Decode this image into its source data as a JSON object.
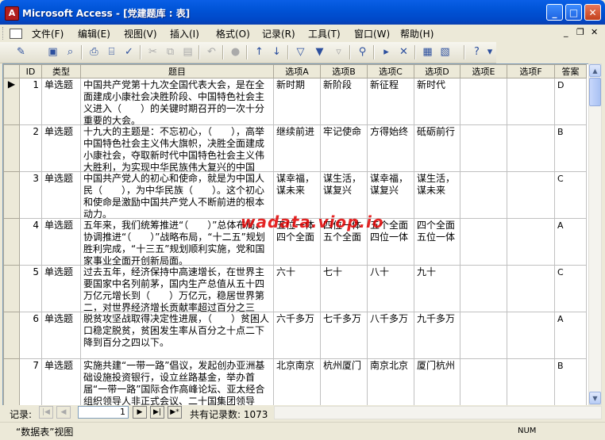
{
  "window": {
    "title": "Microsoft Access - [党建题库 : 表]",
    "app_icon": "access-icon"
  },
  "menubar": {
    "items": [
      {
        "label": "文件(F)"
      },
      {
        "label": "编辑(E)"
      },
      {
        "label": "视图(V)"
      },
      {
        "label": "插入(I)"
      },
      {
        "label": "格式(O)"
      },
      {
        "label": "记录(R)"
      },
      {
        "label": "工具(T)"
      },
      {
        "label": "窗口(W)"
      },
      {
        "label": "帮助(H)"
      }
    ]
  },
  "grid": {
    "columns": [
      "ID",
      "类型",
      "题目",
      "选项A",
      "选项B",
      "选项C",
      "选项D",
      "选项E",
      "选项F",
      "答案"
    ],
    "rows": [
      {
        "id": "1",
        "type": "单选题",
        "question": "中国共产党第十九次全国代表大会，是在全面建成小康社会决胜阶段、中国特色社会主义进入（　　）的关键时期召开的一次十分重要的大会。",
        "a": "新时期",
        "b": "新阶段",
        "c": "新征程",
        "d": "新时代",
        "e": "",
        "f": "",
        "answer": "D"
      },
      {
        "id": "2",
        "type": "单选题",
        "question": "十九大的主题是：不忘初心，（　　），高举中国特色社会主义伟大旗帜，决胜全面建成小康社会，夺取新时代中国特色社会主义伟大胜利，为实现中华民族伟大复兴的中国",
        "a": "继续前进",
        "b": "牢记使命",
        "c": "方得始终",
        "d": "砥砺前行",
        "e": "",
        "f": "",
        "answer": "B"
      },
      {
        "id": "3",
        "type": "单选题",
        "question": "中国共产党人的初心和使命，就是为中国人民（　　），为中华民族（　　）。这个初心和使命是激励中国共产党人不断前进的根本动力。",
        "a": "谋幸福，谋未来",
        "b": "谋生活，谋复兴",
        "c": "谋幸福，谋复兴",
        "d": "谋生活，谋未来",
        "e": "",
        "f": "",
        "answer": "C"
      },
      {
        "id": "4",
        "type": "单选题",
        "question": "五年来，我们统筹推进“（　　）”总体布局、协调推进“（　　）”战略布局，“十二五”规划胜利完成，“十三五”规划顺利实施，党和国家事业全面开创新局面。",
        "a": "五位一体 四个全面",
        "b": "四位一体 五个全面",
        "c": "五个全面 四位一体",
        "d": "四个全面 五位一体",
        "e": "",
        "f": "",
        "answer": "A"
      },
      {
        "id": "5",
        "type": "单选题",
        "question": "过去五年，经济保持中高速增长，在世界主要国家中名列前茅，国内生产总值从五十四万亿元增长到（　　）万亿元，稳居世界第二，对世界经济增长贡献率超过百分之三",
        "a": "六十",
        "b": "七十",
        "c": "八十",
        "d": "九十",
        "e": "",
        "f": "",
        "answer": "C"
      },
      {
        "id": "6",
        "type": "单选题",
        "question": "脱贫攻坚战取得决定性进展，（　　）贫困人口稳定脱贫，贫困发生率从百分之十点二下降到百分之四以下。",
        "a": "六千多万",
        "b": "七千多万",
        "c": "八千多万",
        "d": "九千多万",
        "e": "",
        "f": "",
        "answer": "A"
      },
      {
        "id": "7",
        "type": "单选题",
        "question": "实施共建“一带一路”倡议，发起创办亚洲基础设施投资银行，设立丝路基金，举办首届“一带一路”国际合作高峰论坛、亚太经合组织领导人非正式会议、二十国集团领导",
        "a": "北京南京",
        "b": "杭州厦门",
        "c": "南京北京",
        "d": "厦门杭州",
        "e": "",
        "f": "",
        "answer": "B"
      }
    ]
  },
  "navigation": {
    "label": "记录:",
    "current": "1",
    "count_text": "共有记录数: 1073"
  },
  "status": {
    "view_text": "“数据表”视图",
    "num_indicator": "NUM"
  },
  "overlay": {
    "watermark": "wadata.viop.io"
  },
  "colors": {
    "title_bar": "#0053d6",
    "watermark": "#e00000",
    "chrome": "#ece9d8"
  }
}
